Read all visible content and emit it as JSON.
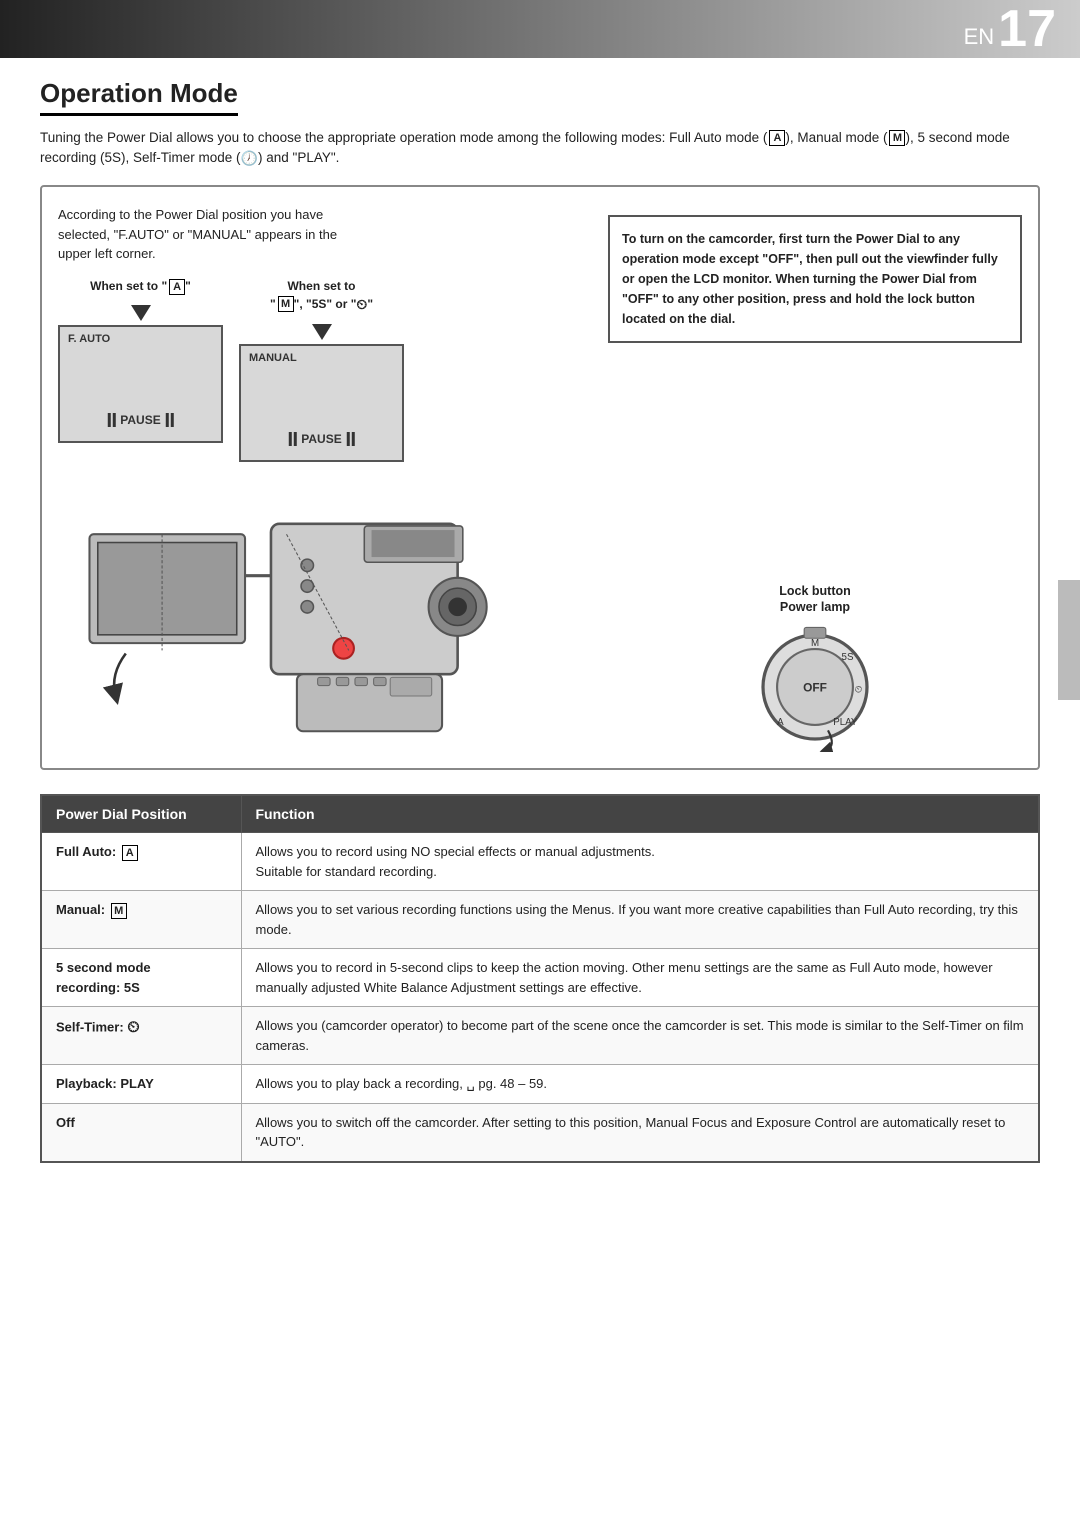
{
  "header": {
    "en_label": "EN",
    "page_number": "17",
    "gradient_dark": "#222222",
    "gradient_light": "#cccccc"
  },
  "page": {
    "title": "Operation Mode",
    "intro": "Tuning the Power Dial allows you to choose the appropriate operation mode among the following modes: Full Auto mode (Ⓐ), Manual mode (ⓜ), 5 second mode recording (5S), Self-Timer mode (♈) and \"PLAY\"."
  },
  "diagram": {
    "callout_text": "According to the Power Dial position you have selected, \"F.AUTO\" or \"MANUAL\" appears in the upper left corner.",
    "screen1": {
      "when_label": "When set to \"Ⓐ\"",
      "mode_label": "F. AUTO",
      "pause_label": "PAUSE"
    },
    "screen2": {
      "when_label": "When set to \"ⓜ\", \"5S\" or \"♈\"",
      "mode_label": "MANUAL",
      "pause_label": "PAUSE"
    },
    "instruction": "To turn on the camcorder, first turn the Power Dial to any operation mode except \"OFF\", then pull out the viewfinder fully or open the LCD monitor. When turning the Power Dial from \"OFF\" to any other position, press and hold the lock button located on the dial.",
    "lock_button_label": "Lock button",
    "power_lamp_label": "Power lamp"
  },
  "table": {
    "col1_header": "Power Dial Position",
    "col2_header": "Function",
    "rows": [
      {
        "position": "Full Auto: Ⓐ",
        "function": "Allows you to record using NO special effects or manual adjustments. Suitable for standard recording."
      },
      {
        "position": "Manual: ⓜ",
        "function": "Allows you to set various recording functions using the Menus. If you want more creative capabilities than Full Auto recording, try this mode."
      },
      {
        "position": "5 second mode recording: 5S",
        "function": "Allows you to record in 5-second clips to keep the action moving. Other menu settings are the same as Full Auto mode, however manually adjusted White Balance Adjustment settings are effective."
      },
      {
        "position": "Self-Timer: ♈",
        "function": "Allows you (camcorder operator) to become part of the scene once the camcorder is set. This mode is similar to the Self-Timer on film cameras."
      },
      {
        "position": "Playback: PLAY",
        "function": "Allows you to play back a recording, ␣ pg. 48 – 59."
      },
      {
        "position": "Off",
        "function": "Allows you to switch off the camcorder. After setting to this position, Manual Focus and Exposure Control are automatically reset to \"AUTO\"."
      }
    ]
  }
}
